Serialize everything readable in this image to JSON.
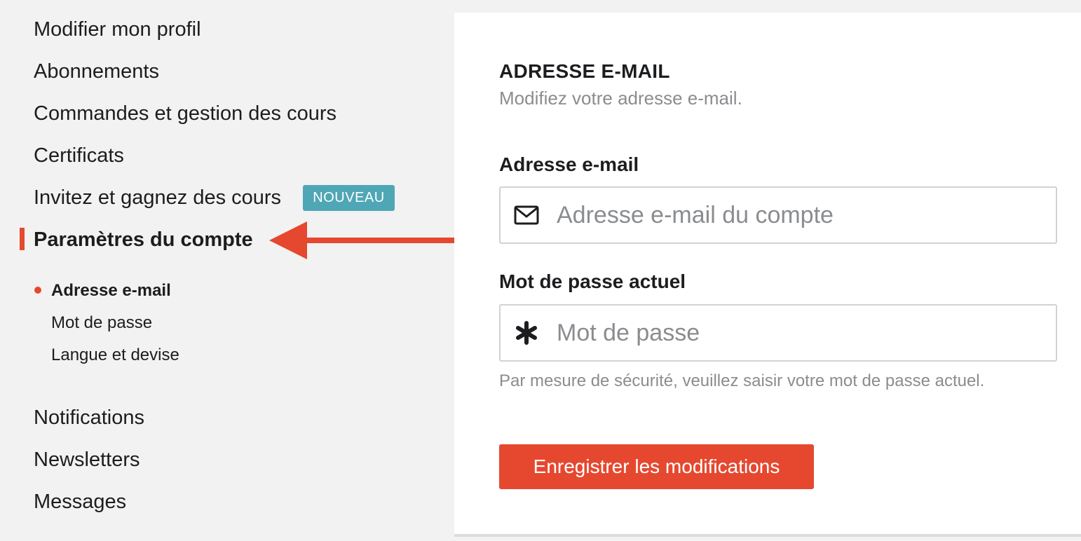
{
  "sidebar": {
    "items_top": [
      {
        "label": "Modifier mon profil"
      },
      {
        "label": "Abonnements"
      },
      {
        "label": "Commandes et gestion des cours"
      },
      {
        "label": "Certificats"
      },
      {
        "label": "Invitez et gagnez des cours",
        "badge": "NOUVEAU"
      },
      {
        "label": "Paramètres du compte"
      }
    ],
    "sub_items": [
      {
        "label": "Adresse e-mail"
      },
      {
        "label": "Mot de passe"
      },
      {
        "label": "Langue et devise"
      }
    ],
    "items_bottom": [
      {
        "label": "Notifications"
      },
      {
        "label": "Newsletters"
      },
      {
        "label": "Messages"
      }
    ]
  },
  "main": {
    "section_title": "ADRESSE E-MAIL",
    "section_subtitle": "Modifiez votre adresse e-mail.",
    "email_field": {
      "label": "Adresse e-mail",
      "value": "",
      "placeholder": "Adresse e-mail du compte",
      "icon": "envelope-icon"
    },
    "password_field": {
      "label": "Mot de passe actuel",
      "value": "",
      "placeholder": "Mot de passe",
      "icon": "asterisk-icon",
      "help": "Par mesure de sécurité, veuillez saisir votre mot de passe actuel."
    },
    "save_label": "Enregistrer les modifications"
  },
  "colors": {
    "accent": "#e5482f",
    "badge": "#4fa7b6",
    "sidebar_bg": "#f2f2f2",
    "panel_bg": "#ffffff",
    "muted_text": "#8a8c8f"
  }
}
